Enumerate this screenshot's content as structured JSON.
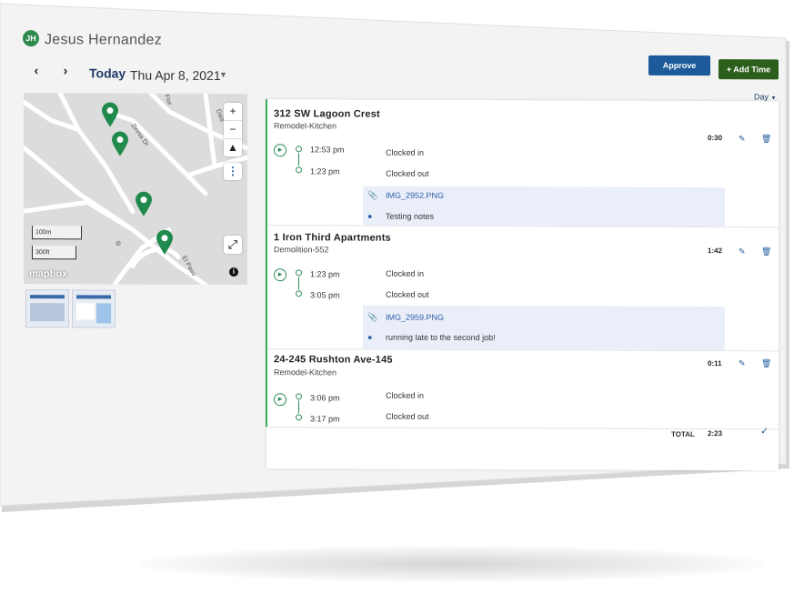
{
  "employee": {
    "initials": "JH",
    "name": "Jesus Hernandez"
  },
  "date_nav": {
    "prev_icon": "chevron-left-icon",
    "next_icon": "chevron-right-icon",
    "today_label": "Today",
    "date": "Thu Apr 8, 2021",
    "caret_icon": "caret-down-icon"
  },
  "actions": {
    "approve_label": "Approve",
    "add_time_label": "+ Add Time",
    "view_label": "Day"
  },
  "map": {
    "zoom_in": "+",
    "zoom_out": "−",
    "compass": "▲",
    "menu": "⋮",
    "scale_m": "100m",
    "scale_ft": "300ft",
    "attribution": "mapbox",
    "streets": [
      "Zinnia Dr",
      "Flor",
      "Dais",
      "El Paso"
    ],
    "road_color": "#ffffff",
    "land_color": "#dcdcdc",
    "marker_color": "#1f8a4c"
  },
  "jobs": [
    {
      "title": "312 SW Lagoon Crest",
      "subtitle": "Remodel-Kitchen",
      "duration": "0:30",
      "clock_in": {
        "time": "12:53 pm",
        "label": "Clocked in"
      },
      "clock_out": {
        "time": "1:23 pm",
        "label": "Clocked out"
      },
      "attachment": "IMG_2952.PNG",
      "note": "Testing notes"
    },
    {
      "title": "1 Iron Third Apartments",
      "subtitle": "Demolition-552",
      "duration": "1:42",
      "clock_in": {
        "time": "1:23 pm",
        "label": "Clocked in"
      },
      "clock_out": {
        "time": "3:05 pm",
        "label": "Clocked out"
      },
      "attachment": "IMG_2959.PNG",
      "note": "running late to the second job!"
    },
    {
      "title": "24-245 Rushton Ave-145",
      "subtitle": "Remodel-Kitchen",
      "duration": "0:11",
      "clock_in": {
        "time": "3:06 pm",
        "label": "Clocked in"
      },
      "clock_out": {
        "time": "3:17 pm",
        "label": "Clocked out"
      }
    }
  ],
  "total": {
    "label": "TOTAL",
    "value": "2:23"
  },
  "colors": {
    "approve": "#1d5a9a",
    "add_time": "#2c5e1c",
    "accent_green": "#2c8a56",
    "link_blue": "#2f5fa8",
    "attachment_bg": "#e9eef9"
  }
}
